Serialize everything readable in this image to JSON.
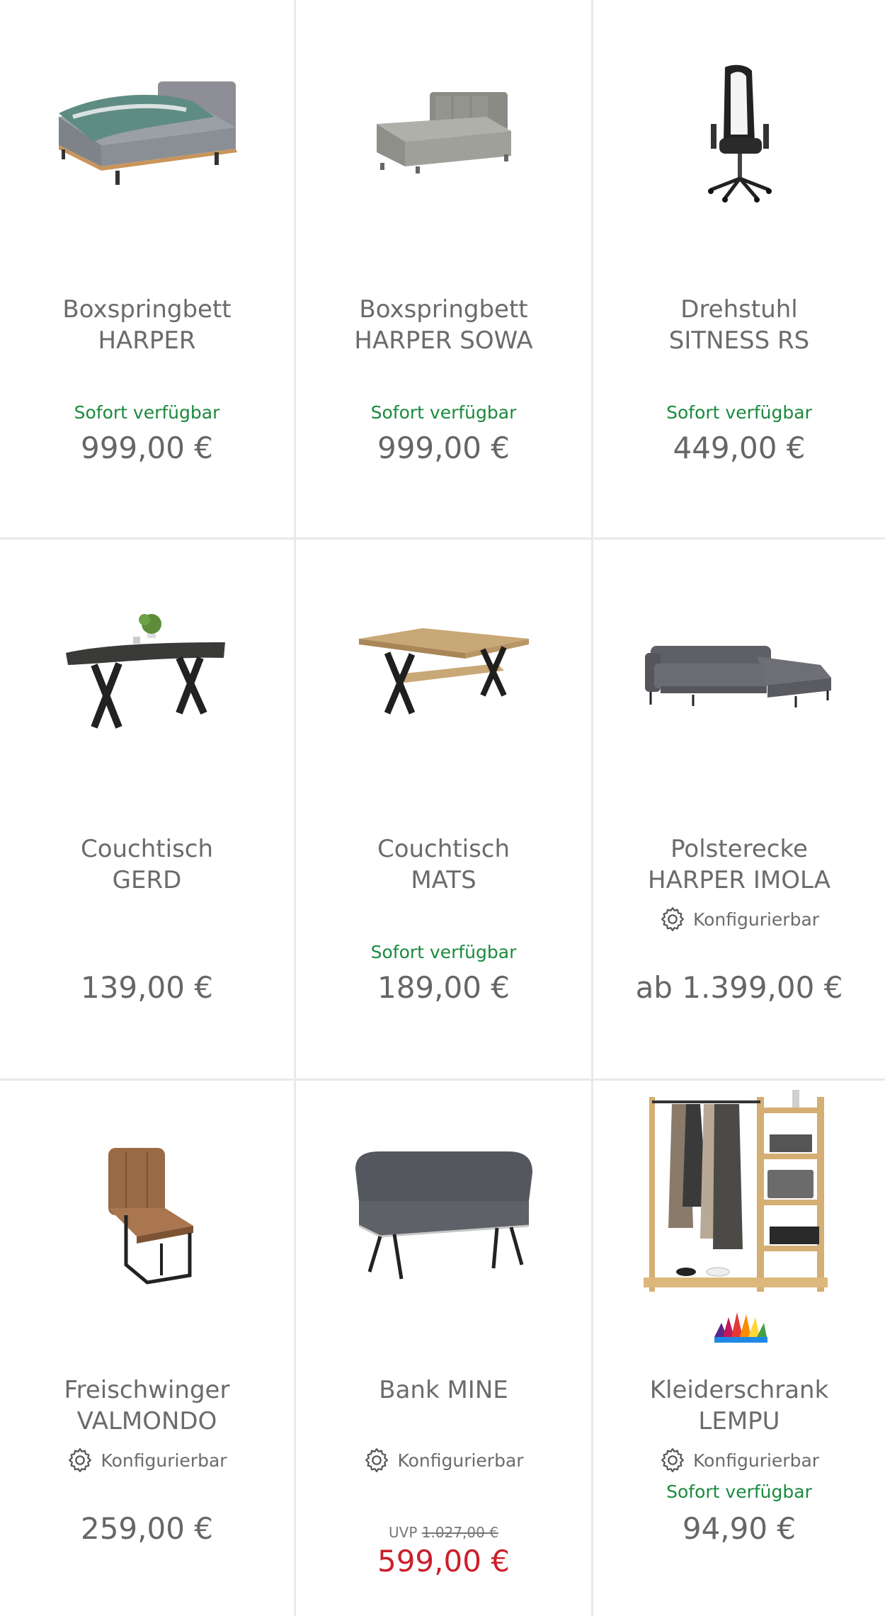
{
  "products": [
    {
      "name_line1": "Boxspringbett",
      "name_line2": "HARPER",
      "availability": "Sofort verfügbar",
      "price": "999,00 €"
    },
    {
      "name_line1": "Boxspringbett",
      "name_line2": "HARPER SOWA",
      "availability": "Sofort verfügbar",
      "price": "999,00 €"
    },
    {
      "name_line1": "Drehstuhl",
      "name_line2": "SITNESS RS",
      "availability": "Sofort verfügbar",
      "price": "449,00 €"
    },
    {
      "name_line1": "Couchtisch",
      "name_line2": "GERD",
      "price": "139,00 €"
    },
    {
      "name_line1": "Couchtisch",
      "name_line2": "MATS",
      "availability": "Sofort verfügbar",
      "price": "189,00 €"
    },
    {
      "name_line1": "Polsterecke",
      "name_line2": "HARPER IMOLA",
      "config": "Konfigurierbar",
      "price": "ab 1.399,00 €"
    },
    {
      "name_line1": "Freischwinger",
      "name_line2": "VALMONDO",
      "config": "Konfigurierbar",
      "price": "259,00 €"
    },
    {
      "name_line1": "Bank MINE",
      "config": "Konfigurierbar",
      "uvp_label": "UVP",
      "uvp_price": "1.027,00 €",
      "price": "599,00 €"
    },
    {
      "name_line1": "Kleiderschrank",
      "name_line2": "LEMPU",
      "config": "Konfigurierbar",
      "availability": "Sofort verfügbar",
      "price": "94,90 €"
    }
  ],
  "colors": {
    "availability": "#1a8a3e",
    "sale_price": "#cc1f2b",
    "text": "#6b6b6b",
    "divider": "#e9e9e9"
  }
}
